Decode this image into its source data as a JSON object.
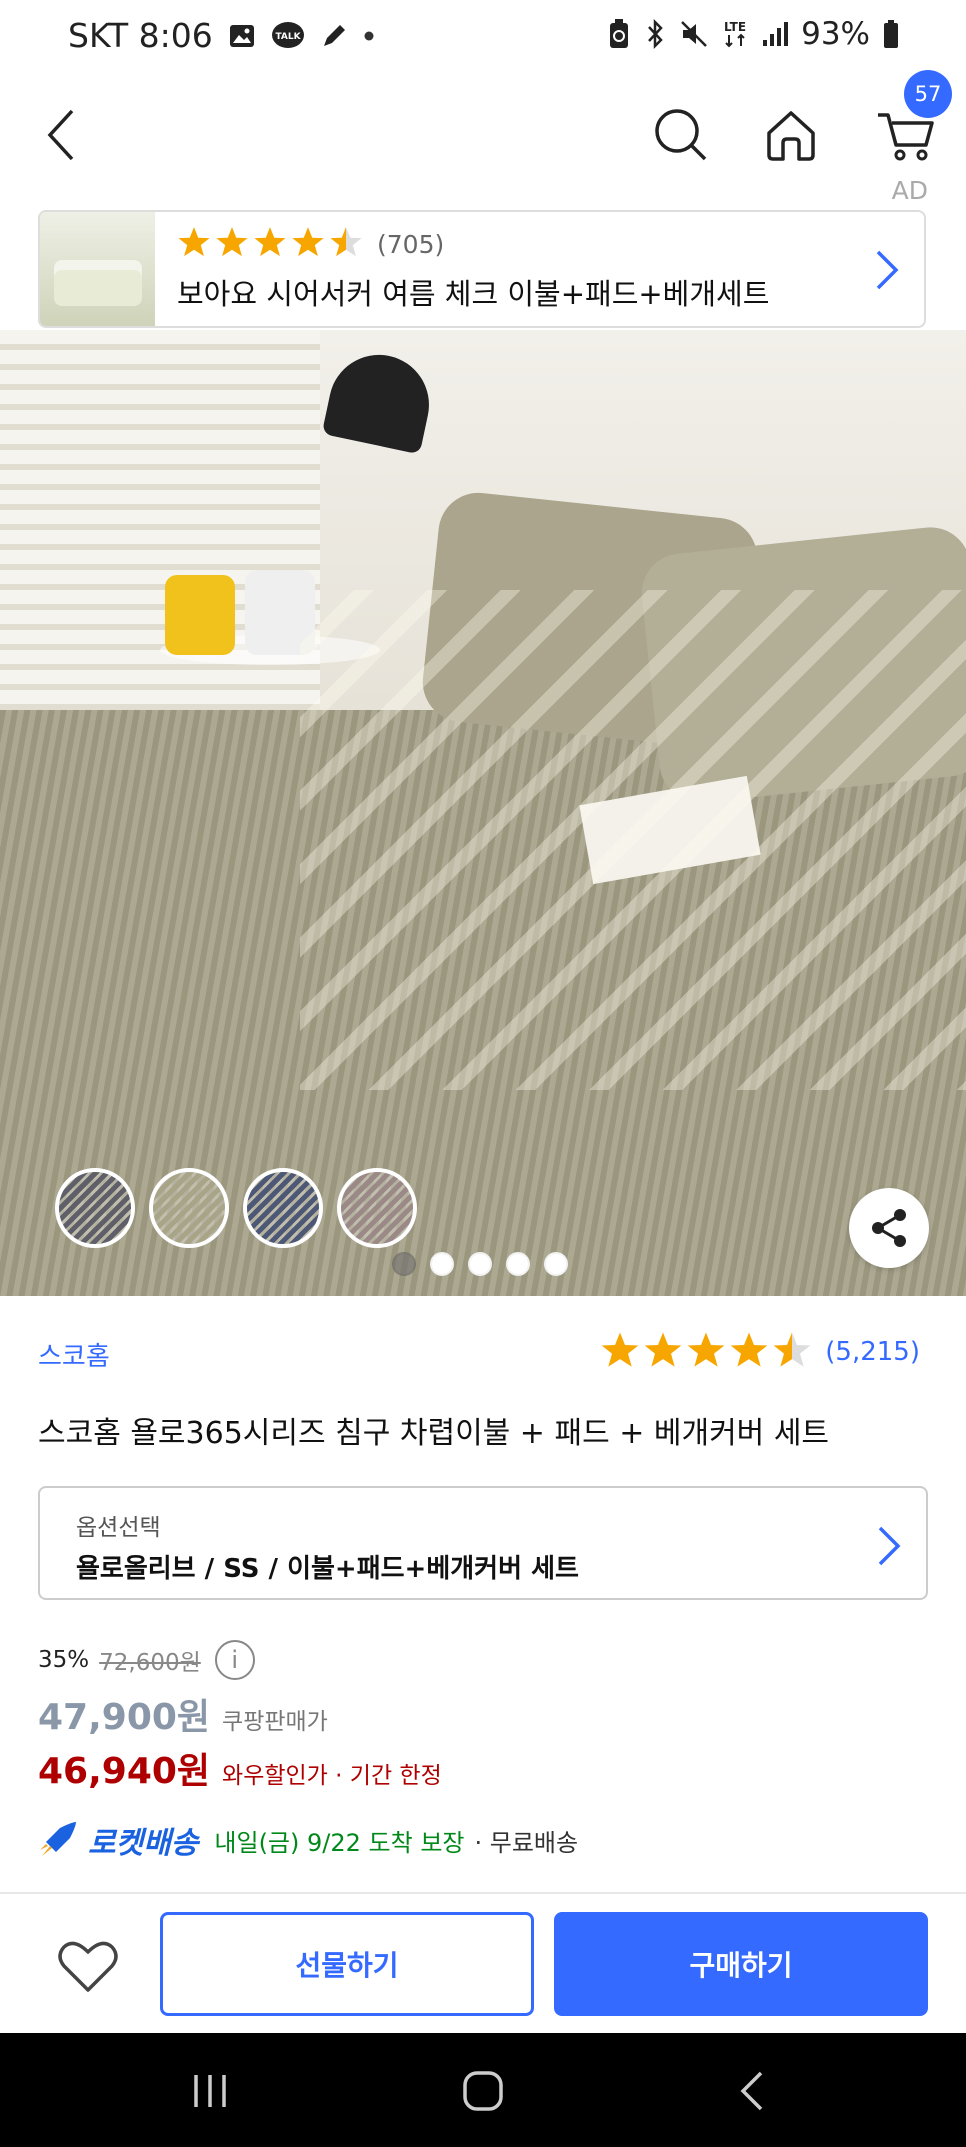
{
  "status_bar": {
    "carrier_time": "SKT 8:06",
    "battery": "93%",
    "network": "LTE"
  },
  "nav": {
    "cart_count": "57"
  },
  "ad": {
    "label": "AD",
    "rating_count": "(705)",
    "title": "보아요 시어서커 여름 체크 이불+패드+베개세트",
    "stars": 4.5
  },
  "gallery": {
    "total_dots": 5,
    "active_dot": 0,
    "swatch_colors": [
      "#5e5f68",
      "#a8a488",
      "#4c5876",
      "#9a8986"
    ]
  },
  "product": {
    "brand": "스코홈",
    "rating_count": "(5,215)",
    "stars": 4.5,
    "title": "스코홈 욜로365시리즈 침구 차렵이불 + 패드 + 베개커버 세트"
  },
  "option": {
    "label": "옵션선택",
    "value": "욜로올리브 / SS / 이불+패드+베개커버 세트"
  },
  "price": {
    "discount": "35%",
    "original": "72,600원",
    "coupang_price": "47,900원",
    "coupang_label": "쿠팡판매가",
    "wow_price": "46,940원",
    "wow_label": "와우할인가 · 기간 한정"
  },
  "delivery": {
    "rocket_label": "로켓배송",
    "date": "내일(금) 9/22 도착 보장",
    "free": "· 무료배송"
  },
  "actions": {
    "gift": "선물하기",
    "buy": "구매하기"
  },
  "colors": {
    "accent": "#346aff",
    "star": "#f7a600",
    "wow_red": "#ae0000",
    "delivery_green": "#00891a"
  }
}
